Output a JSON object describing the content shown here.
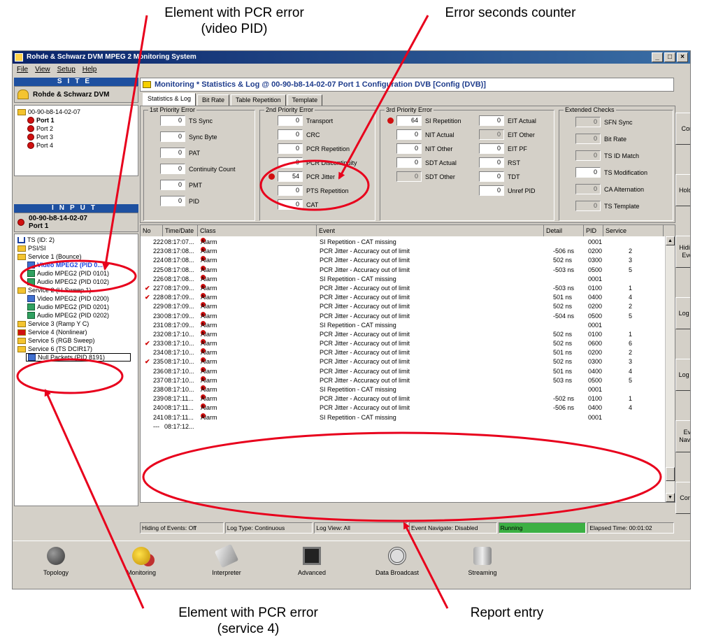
{
  "callouts": {
    "top_left": [
      "Element with PCR error",
      "(video PID)"
    ],
    "top_right": "Error seconds counter",
    "bottom_left": [
      "Element with PCR error",
      "(service 4)"
    ],
    "bottom_right": "Report entry"
  },
  "window": {
    "title": "Rohde & Schwarz DVM MPEG 2 Monitoring System",
    "controls": [
      "_",
      "□",
      "×"
    ]
  },
  "menu": [
    "File",
    "View",
    "Setup",
    "Help"
  ],
  "site": {
    "header": "SITE",
    "device": "Rohde & Schwarz DVM",
    "tree": [
      {
        "label": "00-90-b8-14-02-07",
        "level": 0,
        "icon": "folder"
      },
      {
        "label": "Port 1",
        "level": 1,
        "icon": "alarm",
        "bold": true
      },
      {
        "label": "Port 2",
        "level": 1,
        "icon": "alarm"
      },
      {
        "label": "Port 3",
        "level": 1,
        "icon": "alarm"
      },
      {
        "label": "Port 4",
        "level": 1,
        "icon": "alarm"
      }
    ]
  },
  "input": {
    "header": "INPUT",
    "device_line1": "00-90-b8-14-02-07",
    "device_line2": "Port 1",
    "tree": [
      {
        "label": "TS (ID: 2)",
        "level": 0,
        "icon": "ts"
      },
      {
        "label": "PSI/SI",
        "level": 0,
        "icon": "folder"
      },
      {
        "label": "Service 1 (Bounce)",
        "level": 0,
        "icon": "folder"
      },
      {
        "label": "Video MPEG2 (PID 0...",
        "level": 1,
        "icon": "video",
        "highlight": true
      },
      {
        "label": "Audio MPEG2 (PID 0101)",
        "level": 1,
        "icon": "audio"
      },
      {
        "label": "Audio MPEG2 (PID 0102)",
        "level": 1,
        "icon": "audio"
      },
      {
        "label": "Service 2 (H-Sweep 1)",
        "level": 0,
        "icon": "folder"
      },
      {
        "label": "Video MPEG2 (PID 0200)",
        "level": 1,
        "icon": "video"
      },
      {
        "label": "Audio MPEG2 (PID 0201)",
        "level": 1,
        "icon": "audio"
      },
      {
        "label": "Audio MPEG2 (PID 0202)",
        "level": 1,
        "icon": "audio"
      },
      {
        "label": "Service 3 (Ramp Y C)",
        "level": 0,
        "icon": "folder"
      },
      {
        "label": "Service 4 (Nonlinear)",
        "level": 0,
        "icon": "folder-alarm"
      },
      {
        "label": "Service 5 (RGB Sweep)",
        "level": 0,
        "icon": "folder"
      },
      {
        "label": "Service 6 (TS DCIR17)",
        "level": 0,
        "icon": "folder"
      },
      {
        "label": "Null Packets (PID 8191)",
        "level": 1,
        "icon": "null",
        "boxed": true
      }
    ]
  },
  "main_title": "Monitoring * Statistics & Log @ 00-90-b8-14-02-07 Port 1 Configuration DVB [Config (DVB)]",
  "tabs": [
    "Statistics & Log",
    "Bit Rate",
    "Table Repetition",
    "Template"
  ],
  "groups": [
    "1st Priority Error",
    "2nd Priority Error",
    "3rd Priority Error",
    "Extended Checks"
  ],
  "p1": [
    {
      "value": "0",
      "label": "TS Sync"
    },
    {
      "value": "0",
      "label": "Sync Byte"
    },
    {
      "value": "0",
      "label": "PAT"
    },
    {
      "value": "0",
      "label": "Continuity Count"
    },
    {
      "value": "0",
      "label": "PMT"
    },
    {
      "value": "0",
      "label": "PID"
    }
  ],
  "p2": [
    {
      "value": "0",
      "label": "Transport"
    },
    {
      "value": "0",
      "label": "CRC"
    },
    {
      "value": "0",
      "label": "PCR Repetition"
    },
    {
      "value": "0",
      "label": "PCR Discontinuity"
    },
    {
      "value": "54",
      "label": "PCR Jitter",
      "alarm": true
    },
    {
      "value": "0",
      "label": "PTS Repetition"
    },
    {
      "value": "0",
      "label": "CAT"
    }
  ],
  "p3a": [
    {
      "value": "64",
      "label": "SI Repetition",
      "alarm": true
    },
    {
      "value": "0",
      "label": "NIT Actual"
    },
    {
      "value": "0",
      "label": "NIT Other"
    },
    {
      "value": "0",
      "label": "SDT Actual"
    },
    {
      "value": "0",
      "label": "SDT Other",
      "disabled": true
    }
  ],
  "p3b": [
    {
      "value": "0",
      "label": "EIT Actual"
    },
    {
      "value": "0",
      "label": "EIT Other",
      "disabled": true
    },
    {
      "value": "0",
      "label": "EIT PF"
    },
    {
      "value": "0",
      "label": "RST"
    },
    {
      "value": "0",
      "label": "TDT"
    },
    {
      "value": "0",
      "label": "Unref PID"
    }
  ],
  "ext": [
    {
      "value": "0",
      "label": "SFN Sync",
      "disabled": true
    },
    {
      "value": "0",
      "label": "Bit Rate",
      "disabled": true
    },
    {
      "value": "0",
      "label": "TS ID Match",
      "disabled": true
    },
    {
      "value": "0",
      "label": "TS Modification"
    },
    {
      "value": "0",
      "label": "CA Alternation",
      "disabled": true
    },
    {
      "value": "0",
      "label": "TS Template",
      "disabled": true
    }
  ],
  "log": {
    "columns": [
      "No",
      "Time/Date",
      "Class",
      "Event",
      "Detail",
      "PID",
      "Service"
    ],
    "rows": [
      {
        "no": "222",
        "time": "08:17:07...",
        "cls": "Alarm",
        "event": "SI Repetition - CAT missing",
        "detail": "",
        "pid": "0001",
        "svc": ""
      },
      {
        "no": "223",
        "time": "08:17:08...",
        "cls": "Alarm",
        "event": "PCR Jitter - Accuracy out of limit",
        "detail": "-506 ns",
        "pid": "0200",
        "svc": "2"
      },
      {
        "no": "224",
        "time": "08:17:08...",
        "cls": "Alarm",
        "event": "PCR Jitter - Accuracy out of limit",
        "detail": "502 ns",
        "pid": "0300",
        "svc": "3"
      },
      {
        "no": "225",
        "time": "08:17:08...",
        "cls": "Alarm",
        "event": "PCR Jitter - Accuracy out of limit",
        "detail": "-503 ns",
        "pid": "0500",
        "svc": "5"
      },
      {
        "no": "226",
        "time": "08:17:08...",
        "cls": "Alarm",
        "event": "SI Repetition - CAT missing",
        "detail": "",
        "pid": "0001",
        "svc": ""
      },
      {
        "no": "227",
        "time": "08:17:09...",
        "cls": "Alarm",
        "event": "PCR Jitter - Accuracy out of limit",
        "detail": "-503 ns",
        "pid": "0100",
        "svc": "1",
        "flag": "✔"
      },
      {
        "no": "228",
        "time": "08:17:09...",
        "cls": "Alarm",
        "event": "PCR Jitter - Accuracy out of limit",
        "detail": "501 ns",
        "pid": "0400",
        "svc": "4",
        "flag": "✔"
      },
      {
        "no": "229",
        "time": "08:17:09...",
        "cls": "Alarm",
        "event": "PCR Jitter - Accuracy out of limit",
        "detail": "502 ns",
        "pid": "0200",
        "svc": "2"
      },
      {
        "no": "230",
        "time": "08:17:09...",
        "cls": "Alarm",
        "event": "PCR Jitter - Accuracy out of limit",
        "detail": "-504 ns",
        "pid": "0500",
        "svc": "5"
      },
      {
        "no": "231",
        "time": "08:17:09...",
        "cls": "Alarm",
        "event": "SI Repetition - CAT missing",
        "detail": "",
        "pid": "0001",
        "svc": ""
      },
      {
        "no": "232",
        "time": "08:17:10...",
        "cls": "Alarm",
        "event": "PCR Jitter - Accuracy out of limit",
        "detail": "502 ns",
        "pid": "0100",
        "svc": "1"
      },
      {
        "no": "233",
        "time": "08:17:10...",
        "cls": "Alarm",
        "event": "PCR Jitter - Accuracy out of limit",
        "detail": "502 ns",
        "pid": "0600",
        "svc": "6",
        "flag": "✔"
      },
      {
        "no": "234",
        "time": "08:17:10...",
        "cls": "Alarm",
        "event": "PCR Jitter - Accuracy out of limit",
        "detail": "501 ns",
        "pid": "0200",
        "svc": "2"
      },
      {
        "no": "235",
        "time": "08:17:10...",
        "cls": "Alarm",
        "event": "PCR Jitter - Accuracy out of limit",
        "detail": "502 ns",
        "pid": "0300",
        "svc": "3",
        "flag": "✔"
      },
      {
        "no": "236",
        "time": "08:17:10...",
        "cls": "Alarm",
        "event": "PCR Jitter - Accuracy out of limit",
        "detail": "501 ns",
        "pid": "0400",
        "svc": "4"
      },
      {
        "no": "237",
        "time": "08:17:10...",
        "cls": "Alarm",
        "event": "PCR Jitter - Accuracy out of limit",
        "detail": "503 ns",
        "pid": "0500",
        "svc": "5"
      },
      {
        "no": "238",
        "time": "08:17:10...",
        "cls": "Alarm",
        "event": "SI Repetition - CAT missing",
        "detail": "",
        "pid": "0001",
        "svc": ""
      },
      {
        "no": "239",
        "time": "08:17:11...",
        "cls": "Alarm",
        "event": "PCR Jitter - Accuracy out of limit",
        "detail": "-502 ns",
        "pid": "0100",
        "svc": "1"
      },
      {
        "no": "240",
        "time": "08:17:11...",
        "cls": "Alarm",
        "event": "PCR Jitter - Accuracy out of limit",
        "detail": "-506 ns",
        "pid": "0400",
        "svc": "4"
      },
      {
        "no": "241",
        "time": "08:17:11...",
        "cls": "Alarm",
        "event": "SI Repetition - CAT missing",
        "detail": "",
        "pid": "0001",
        "svc": ""
      },
      {
        "no": "---",
        "time": "08:17:12...",
        "cls": "",
        "event": "",
        "detail": "",
        "pid": "",
        "svc": ""
      }
    ]
  },
  "status": {
    "hiding": "Hiding of Events: Off",
    "logtype": "Log Type: Continuous",
    "logview": "Log View: All",
    "navigate": "Event Navigate: Disabled",
    "running": "Running",
    "elapsed": "Elapsed Time: 00:01:02",
    "running_color": "#3cb043"
  },
  "right_buttons": [
    "Control",
    "Hold Log",
    "Hiding of Events",
    "Log Type",
    "Log View",
    "Event Navigate",
    "Config..."
  ],
  "bottom_buttons": [
    {
      "label": "Topology",
      "icon": "globe-icon"
    },
    {
      "label": "Monitoring",
      "icon": "bulb-icon"
    },
    {
      "label": "Interpreter",
      "icon": "eraser-icon"
    },
    {
      "label": "Advanced",
      "icon": "chip-icon"
    },
    {
      "label": "Data Broadcast",
      "icon": "satellite-icon"
    },
    {
      "label": "Streaming",
      "icon": "pipe-icon"
    }
  ],
  "colors": {
    "annotation": "#e8001c",
    "title_blue": "#1e3c8c",
    "header_blue": "#1e50a0"
  }
}
